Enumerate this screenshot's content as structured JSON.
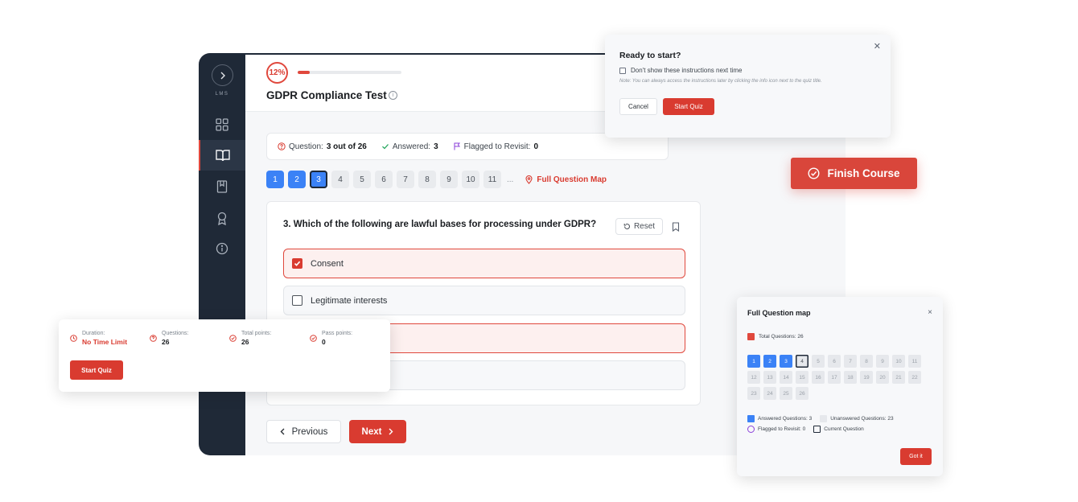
{
  "sidebar": {
    "brand": "LMS",
    "items": [
      {
        "icon": "dashboard-icon"
      },
      {
        "icon": "book-open-icon",
        "active": true
      },
      {
        "icon": "bookmark-book-icon"
      },
      {
        "icon": "award-icon"
      },
      {
        "icon": "info-icon"
      }
    ]
  },
  "header": {
    "progress_label": "12%",
    "progress_value": 0.12,
    "title": "GDPR Compliance Test"
  },
  "stats": {
    "question_label": "Question:",
    "question_value": "3 out of 26",
    "answered_label": "Answered:",
    "answered_value": "3",
    "flagged_label": "Flagged to Revisit:",
    "flagged_value": "0"
  },
  "question_nav": {
    "numbers": [
      "1",
      "2",
      "3",
      "4",
      "5",
      "6",
      "7",
      "8",
      "9",
      "10",
      "11"
    ],
    "ellipsis": "...",
    "full_map_label": "Full Question Map"
  },
  "question": {
    "text": "3. Which of the following are lawful bases for processing under GDPR?",
    "reset_label": "Reset",
    "options": [
      {
        "label": "Consent",
        "checked": true
      },
      {
        "label": "Legitimate interests",
        "checked": false
      }
    ]
  },
  "footer_nav": {
    "previous_label": "Previous",
    "next_label": "Next"
  },
  "ready_popup": {
    "title": "Ready to start?",
    "checkbox_label": "Don't show these instructions next time",
    "note": "Note: You can always access the instructions later by clicking the info icon next to the quiz title.",
    "cancel_label": "Cancel",
    "start_label": "Start Quiz"
  },
  "finish_button": {
    "label": "Finish Course"
  },
  "info_card": {
    "duration_label": "Duration:",
    "duration_value": "No Time Limit",
    "questions_label": "Questions:",
    "questions_value": "26",
    "total_points_label": "Total points:",
    "total_points_value": "26",
    "pass_points_label": "Pass points:",
    "pass_points_value": "0",
    "start_label": "Start Quiz"
  },
  "map_popup": {
    "title": "Full Question map",
    "close_label": "×",
    "total_label": "Total Questions: 26",
    "cells": [
      "1",
      "2",
      "3",
      "4",
      "5",
      "6",
      "7",
      "8",
      "9",
      "10",
      "11",
      "12",
      "13",
      "14",
      "15",
      "16",
      "17",
      "18",
      "19",
      "20",
      "21",
      "22",
      "23",
      "24",
      "25",
      "26"
    ],
    "legend": {
      "answered": "Answered Questions: 3",
      "unanswered": "Unanswered Questions: 23",
      "flagged": "Flagged to Revisit: 0",
      "current": "Current Question"
    },
    "got_it_label": "Got it"
  },
  "colors": {
    "accent": "#d93b30",
    "answered": "#3b82f6",
    "sidebar": "#1f2937"
  }
}
